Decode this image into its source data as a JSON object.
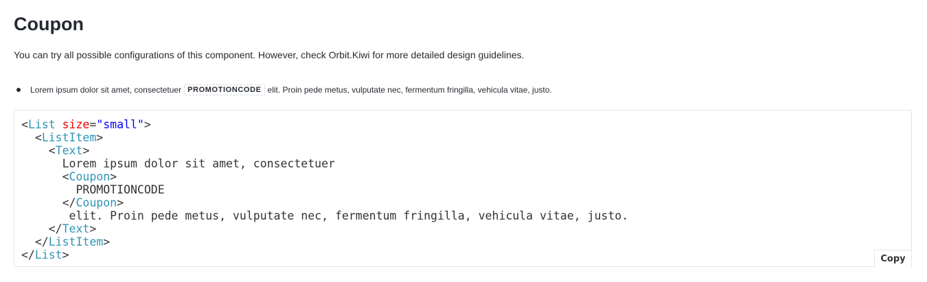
{
  "title": "Coupon",
  "description": "You can try all possible configurations of this component. However, check Orbit.Kiwi for more detailed design guidelines.",
  "preview": {
    "before": "Lorem ipsum dolor sit amet, consectetuer",
    "coupon": "PROMOTIONCODE",
    "after": "elit. Proin pede metus, vulputate nec, fermentum fringilla, vehicula vitae, justo."
  },
  "code": {
    "lt": "<",
    "gt": ">",
    "lts": "</",
    "eq": "=",
    "list": "List",
    "size_attr": "size",
    "size_val": "\"small\"",
    "listitem": "ListItem",
    "text": "Text",
    "coupon": "Coupon",
    "line_lorem": "Lorem ipsum dolor sit amet, consectetuer",
    "line_code": "PROMOTIONCODE",
    "line_elit": "elit. Proin pede metus, vulputate nec, fermentum fringilla, vehicula vitae, justo."
  },
  "copy_label": "Copy"
}
